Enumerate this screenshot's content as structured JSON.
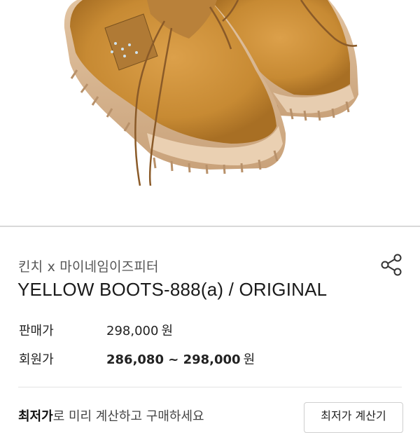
{
  "product": {
    "brand": "킨치 x 마이네임이즈피터",
    "title": "YELLOW BOOTS-888(a) / ORIGINAL",
    "share_icon": "share-icon",
    "image_alt": "yellow boots product photo"
  },
  "pricing": {
    "sale_label": "판매가",
    "sale_price": "298,000",
    "sale_unit": "원",
    "member_label": "회원가",
    "member_price": "286,080 ~ 298,000",
    "member_unit": "원"
  },
  "cta": {
    "highlight": "최저가",
    "text": "로 미리 계산하고 구매하세요",
    "button_label": "최저가 계산기"
  },
  "colors": {
    "boot": "#c98d34",
    "sole": "#d8b48e",
    "lace": "#8a5a28"
  }
}
